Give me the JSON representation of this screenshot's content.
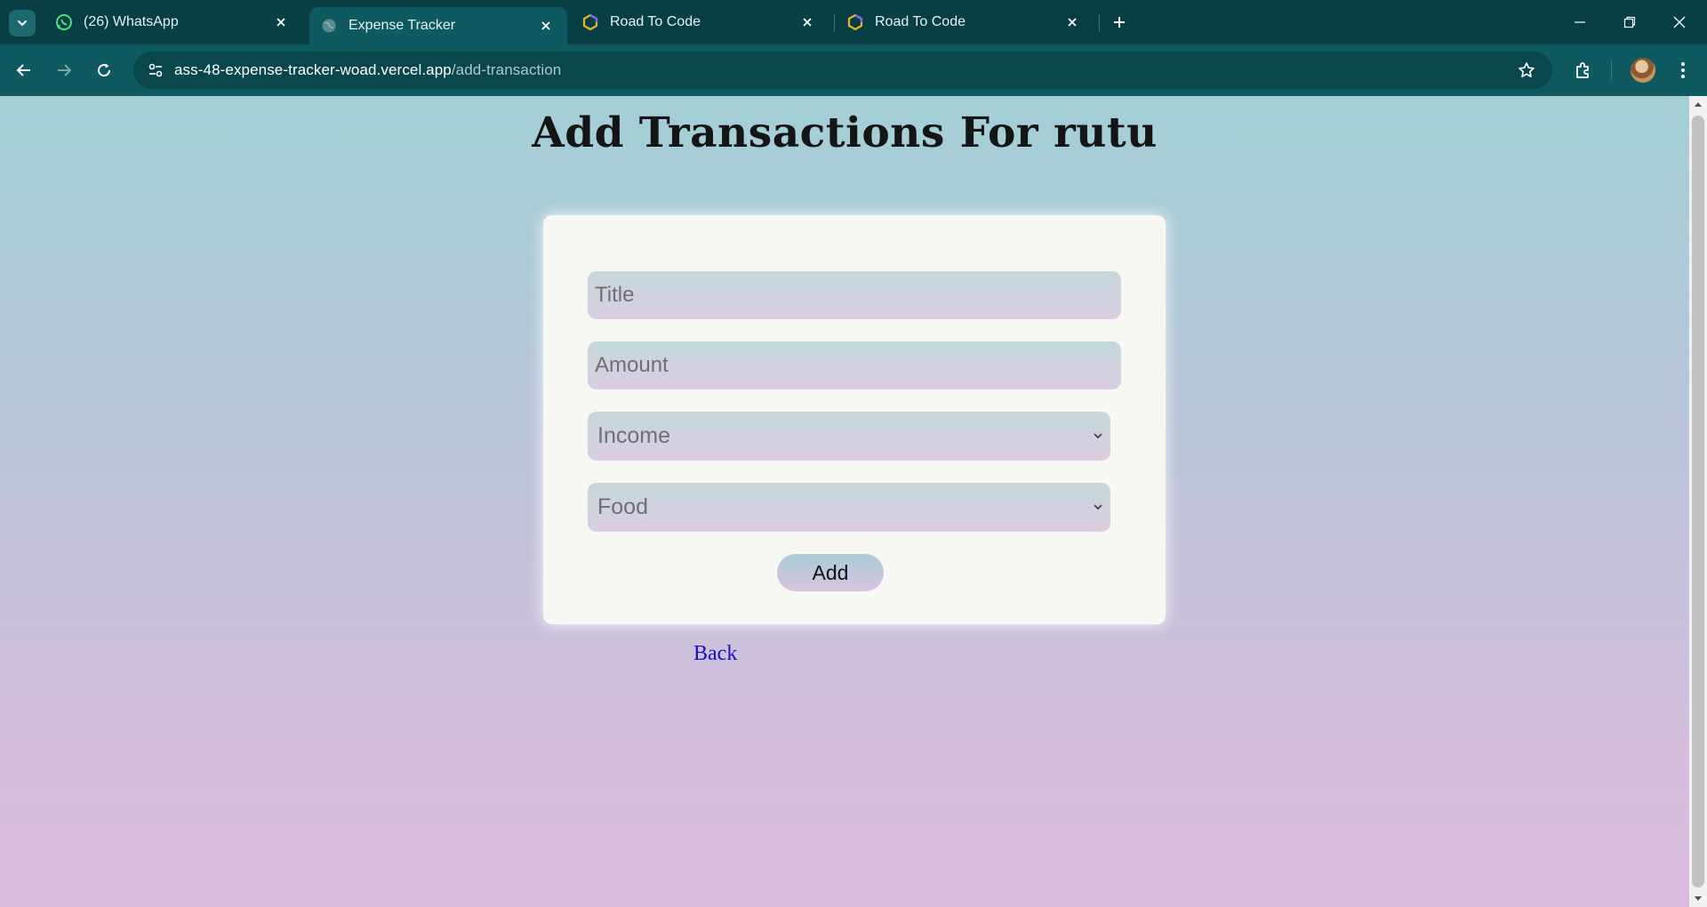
{
  "browser": {
    "tabs": [
      {
        "title": "(26) WhatsApp",
        "favicon": "whatsapp-icon",
        "active": false
      },
      {
        "title": "Expense Tracker",
        "favicon": "globe-icon",
        "active": true
      },
      {
        "title": "Road To Code",
        "favicon": "hexagon-logo-icon",
        "active": false
      },
      {
        "title": "Road To Code",
        "favicon": "hexagon-logo-icon",
        "active": false
      }
    ],
    "url_host": "ass-48-expense-tracker-woad.vercel.app",
    "url_path": "/add-transaction"
  },
  "page": {
    "heading": "Add Transactions For rutu",
    "form": {
      "title_placeholder": "Title",
      "amount_placeholder": "Amount",
      "type_selected": "Income",
      "category_selected": "Food",
      "add_label": "Add"
    },
    "back_label": "Back"
  },
  "colors": {
    "browser_frame": "#073f45",
    "toolbar": "#0e5a60",
    "background_top": "#a3d0d6",
    "background_bottom": "#dcbcde",
    "card": "#f7f7f3",
    "link": "#1a0dcc"
  }
}
